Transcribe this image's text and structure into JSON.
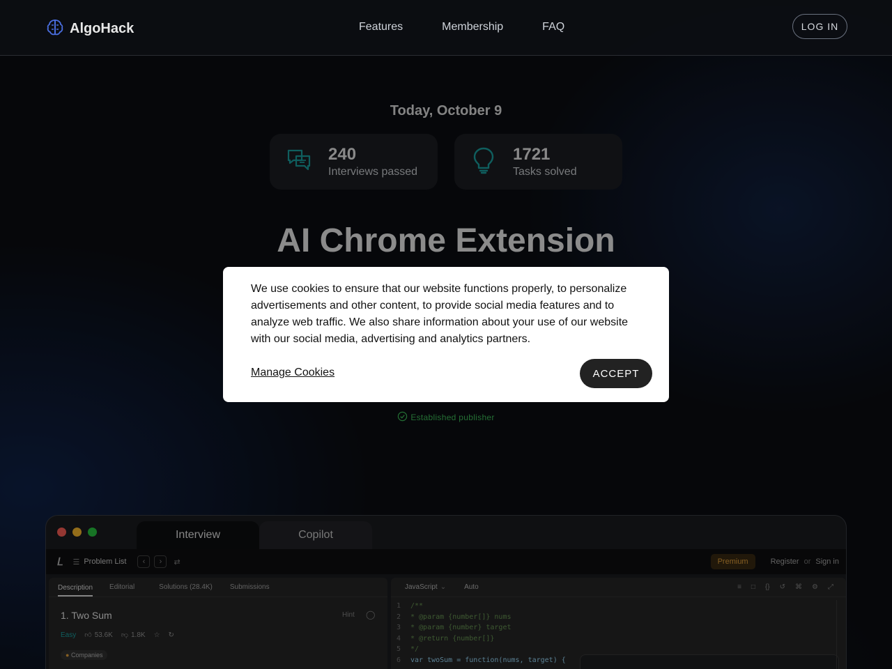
{
  "header": {
    "brand": "AlgoHack",
    "nav": [
      "Features",
      "Membership",
      "FAQ"
    ],
    "login_label": "LOG IN"
  },
  "hero": {
    "date": "Today, October 9",
    "stats": [
      {
        "value": "240",
        "label": "Interviews passed",
        "icon": "chat-bubbles-icon"
      },
      {
        "value": "1721",
        "label": "Tasks solved",
        "icon": "lightbulb-icon"
      }
    ],
    "title": "AI Chrome Extension",
    "publisher": "Established publisher"
  },
  "preview": {
    "tabs": [
      "Interview",
      "Copilot"
    ],
    "toolbar": {
      "problem_list": "Problem List",
      "premium": "Premium",
      "register": "Register",
      "or": "or",
      "sign_in": "Sign in"
    },
    "left_tabs": [
      "Description",
      "Editorial",
      "Solutions (28.4K)",
      "Submissions"
    ],
    "problem": {
      "title": "1. Two Sum",
      "hint": "Hint",
      "difficulty": "Easy",
      "likes": "53.6K",
      "dislikes": "1.8K",
      "companies": "Companies"
    },
    "editor": {
      "language": "JavaScript",
      "mode": "Auto",
      "lines": [
        {
          "n": "1",
          "text": "/**"
        },
        {
          "n": "2",
          "text": " * @param {number[]} nums"
        },
        {
          "n": "3",
          "text": " * @param {number} target"
        },
        {
          "n": "4",
          "text": " * @return {number[]}"
        },
        {
          "n": "5",
          "text": " */"
        },
        {
          "n": "6",
          "text": "var twoSum = function(nums, target) {"
        }
      ]
    }
  },
  "cookie": {
    "message": "We use cookies to ensure that our website functions properly, to personalize advertisements and other content, to provide social media features and to analyze web traffic. We also share information about your use of our website with our social media, advertising and analytics partners.",
    "manage_label": "Manage Cookies",
    "accept_label": "ACCEPT"
  },
  "colors": {
    "accent_teal": "#1aa3a3",
    "brand_blue": "#4a6ee0",
    "success_green": "#3fbf5a",
    "premium_orange": "#e6a23c"
  }
}
